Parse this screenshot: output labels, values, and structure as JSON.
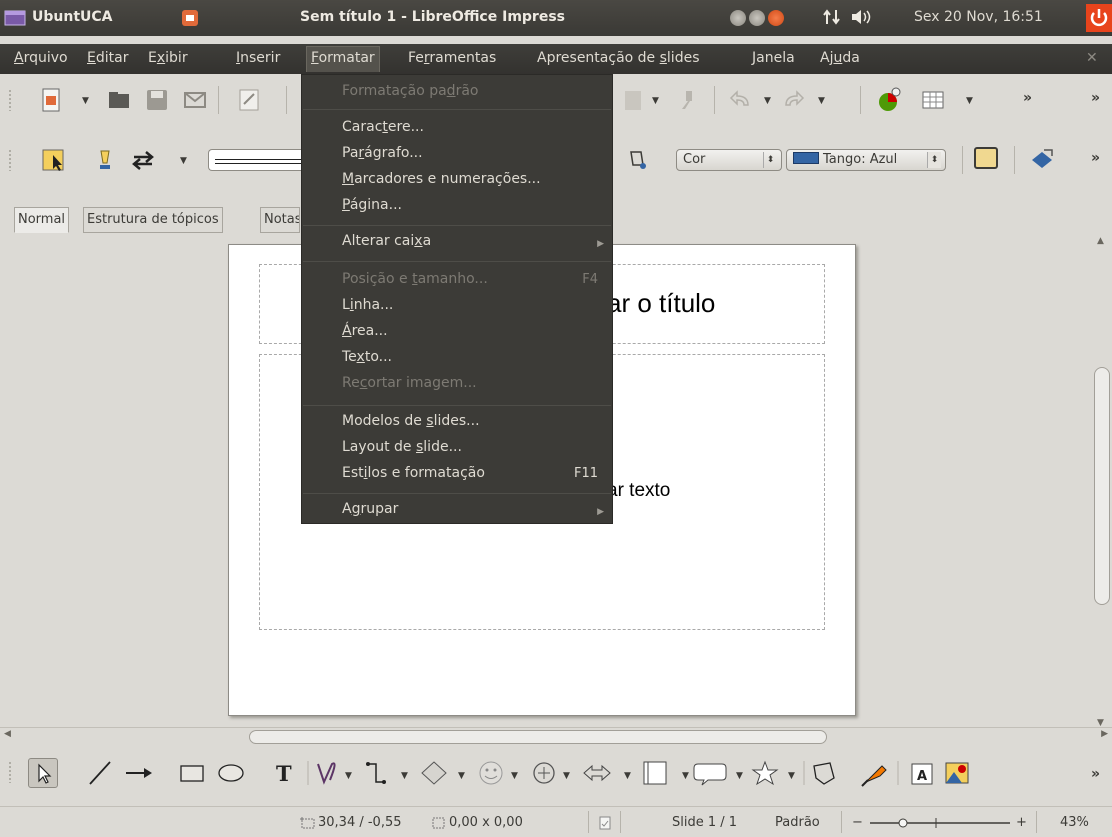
{
  "panel": {
    "app_name": "UbuntUCA",
    "window_title": "Sem título 1 - LibreOffice Impress",
    "clock": "Sex 20 Nov, 16:51"
  },
  "menubar": {
    "items": [
      {
        "pre": "",
        "ul": "A",
        "post": "rquivo"
      },
      {
        "pre": "",
        "ul": "E",
        "post": "ditar"
      },
      {
        "pre": "E",
        "ul": "x",
        "post": "ibir"
      },
      {
        "pre": "",
        "ul": "I",
        "post": "nserir"
      },
      {
        "pre": "",
        "ul": "F",
        "post": "ormatar"
      },
      {
        "pre": "Fe",
        "ul": "r",
        "post": "ramentas"
      },
      {
        "pre": "Apresentação de ",
        "ul": "s",
        "post": "lides"
      },
      {
        "pre": "",
        "ul": "J",
        "post": "anela"
      },
      {
        "pre": "Aj",
        "ul": "u",
        "post": "da"
      }
    ],
    "close_doc": "✕"
  },
  "format_menu": {
    "items": [
      {
        "pre": "Formatação pa",
        "ul": "d",
        "post": "rão",
        "disabled": true
      },
      {
        "pre": "Carac",
        "ul": "t",
        "post": "ere..."
      },
      {
        "pre": "Pa",
        "ul": "r",
        "post": "ágrafo..."
      },
      {
        "pre": "",
        "ul": "M",
        "post": "arcadores e numerações..."
      },
      {
        "pre": "",
        "ul": "P",
        "post": "ágina..."
      },
      {
        "pre": "Alterar cai",
        "ul": "x",
        "post": "a",
        "submenu": true
      },
      {
        "pre": "Posição e ",
        "ul": "t",
        "post": "amanho...",
        "accel": "F4",
        "disabled": true
      },
      {
        "pre": "L",
        "ul": "i",
        "post": "nha..."
      },
      {
        "pre": "",
        "ul": "Á",
        "post": "rea..."
      },
      {
        "pre": "Te",
        "ul": "x",
        "post": "to..."
      },
      {
        "pre": "Re",
        "ul": "c",
        "post": "ortar imagem...",
        "disabled": true
      },
      {
        "pre": "Modelos de ",
        "ul": "s",
        "post": "lides..."
      },
      {
        "pre": "Layout de ",
        "ul": "s",
        "post": "lide..."
      },
      {
        "pre": "Est",
        "ul": "i",
        "post": "los e formatação",
        "accel": "F11"
      },
      {
        "pre": "A",
        "ul": "g",
        "post": "rupar",
        "submenu": true
      }
    ]
  },
  "toolbar2": {
    "fill_type": "Cor",
    "fill_color": "Tango: Azul"
  },
  "view_tabs": [
    "Normal",
    "Estrutura de tópicos",
    "Notas"
  ],
  "slide": {
    "title_placeholder_visible": "ar o título",
    "body_placeholder_visible": "ar texto"
  },
  "statusbar": {
    "position": "30,34 / -0,55",
    "size": "0,00 x 0,00",
    "slide": "Slide 1 / 1",
    "layout": "Padrão",
    "zoom": "43%"
  },
  "colors": {
    "panel_bg": "#3c3b37",
    "menu_bg": "#3c3b37",
    "accent_orange": "#e8441c",
    "window_bg": "#dcdad5"
  }
}
